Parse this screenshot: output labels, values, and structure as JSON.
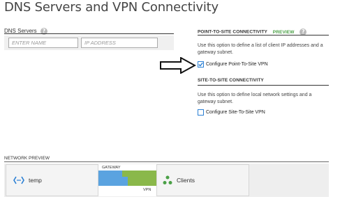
{
  "page": {
    "title": "DNS Servers and VPN Connectivity"
  },
  "dns": {
    "label": "DNS Servers",
    "name_placeholder": "ENTER NAME",
    "ip_placeholder": "IP ADDRESS"
  },
  "p2s": {
    "heading": "POINT-TO-SITE CONNECTIVITY",
    "badge": "PREVIEW",
    "description": "Use this option to define a list of client IP addresses and a gateway subnet.",
    "checkbox_label": "Configure Point-To-Site VPN",
    "checked": true
  },
  "s2s": {
    "heading": "SITE-TO-SITE CONNECTIVITY",
    "description": "Use this option to define local network settings and a gateway subnet.",
    "checkbox_label": "Configure Site-To-Site VPN",
    "checked": false
  },
  "network_preview": {
    "label": "NETWORK PREVIEW",
    "vnet_name": "temp",
    "gateway_label": "GATEWAY",
    "vpn_label": "VPN",
    "clients_label": "Clients"
  },
  "colors": {
    "accent_blue": "#2a7fd4",
    "preview_green": "#4aa046",
    "gateway_blue": "#5aa3e0",
    "gateway_green": "#8ab84a"
  },
  "icons": {
    "help": "question-icon",
    "vnet": "virtual-network-icon",
    "clients": "clients-icon",
    "arrow": "right-arrow-annotation"
  }
}
